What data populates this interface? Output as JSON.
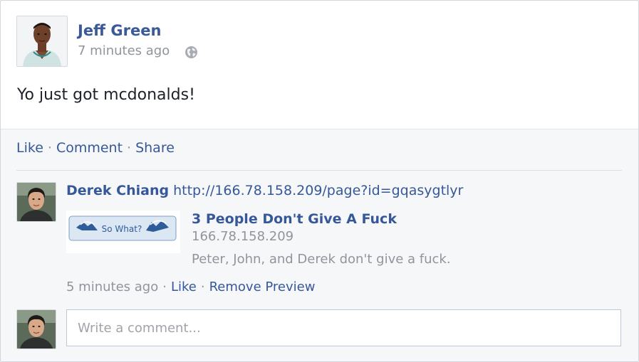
{
  "post": {
    "author": "Jeff Green",
    "timestamp": "7 minutes ago",
    "privacy_icon": "globe-icon",
    "text": "Yo just got mcdonalds!"
  },
  "actions": {
    "like": "Like",
    "comment": "Comment",
    "share": "Share",
    "separator": "·"
  },
  "comment": {
    "author": "Derek Chiang",
    "link_text": "http://166.78.158.209/page?id=gqasygtlyr",
    "preview": {
      "button_label": "So What?",
      "title": "3 People Don't Give A Fuck",
      "domain": "166.78.158.209",
      "description": "Peter, John, and Derek don't give a fuck."
    },
    "timestamp": "5 minutes ago",
    "like": "Like",
    "remove_preview": "Remove Preview"
  },
  "composer": {
    "placeholder": "Write a comment..."
  },
  "colors": {
    "link": "#365899",
    "name": "#3b5998",
    "muted": "#90949c"
  }
}
